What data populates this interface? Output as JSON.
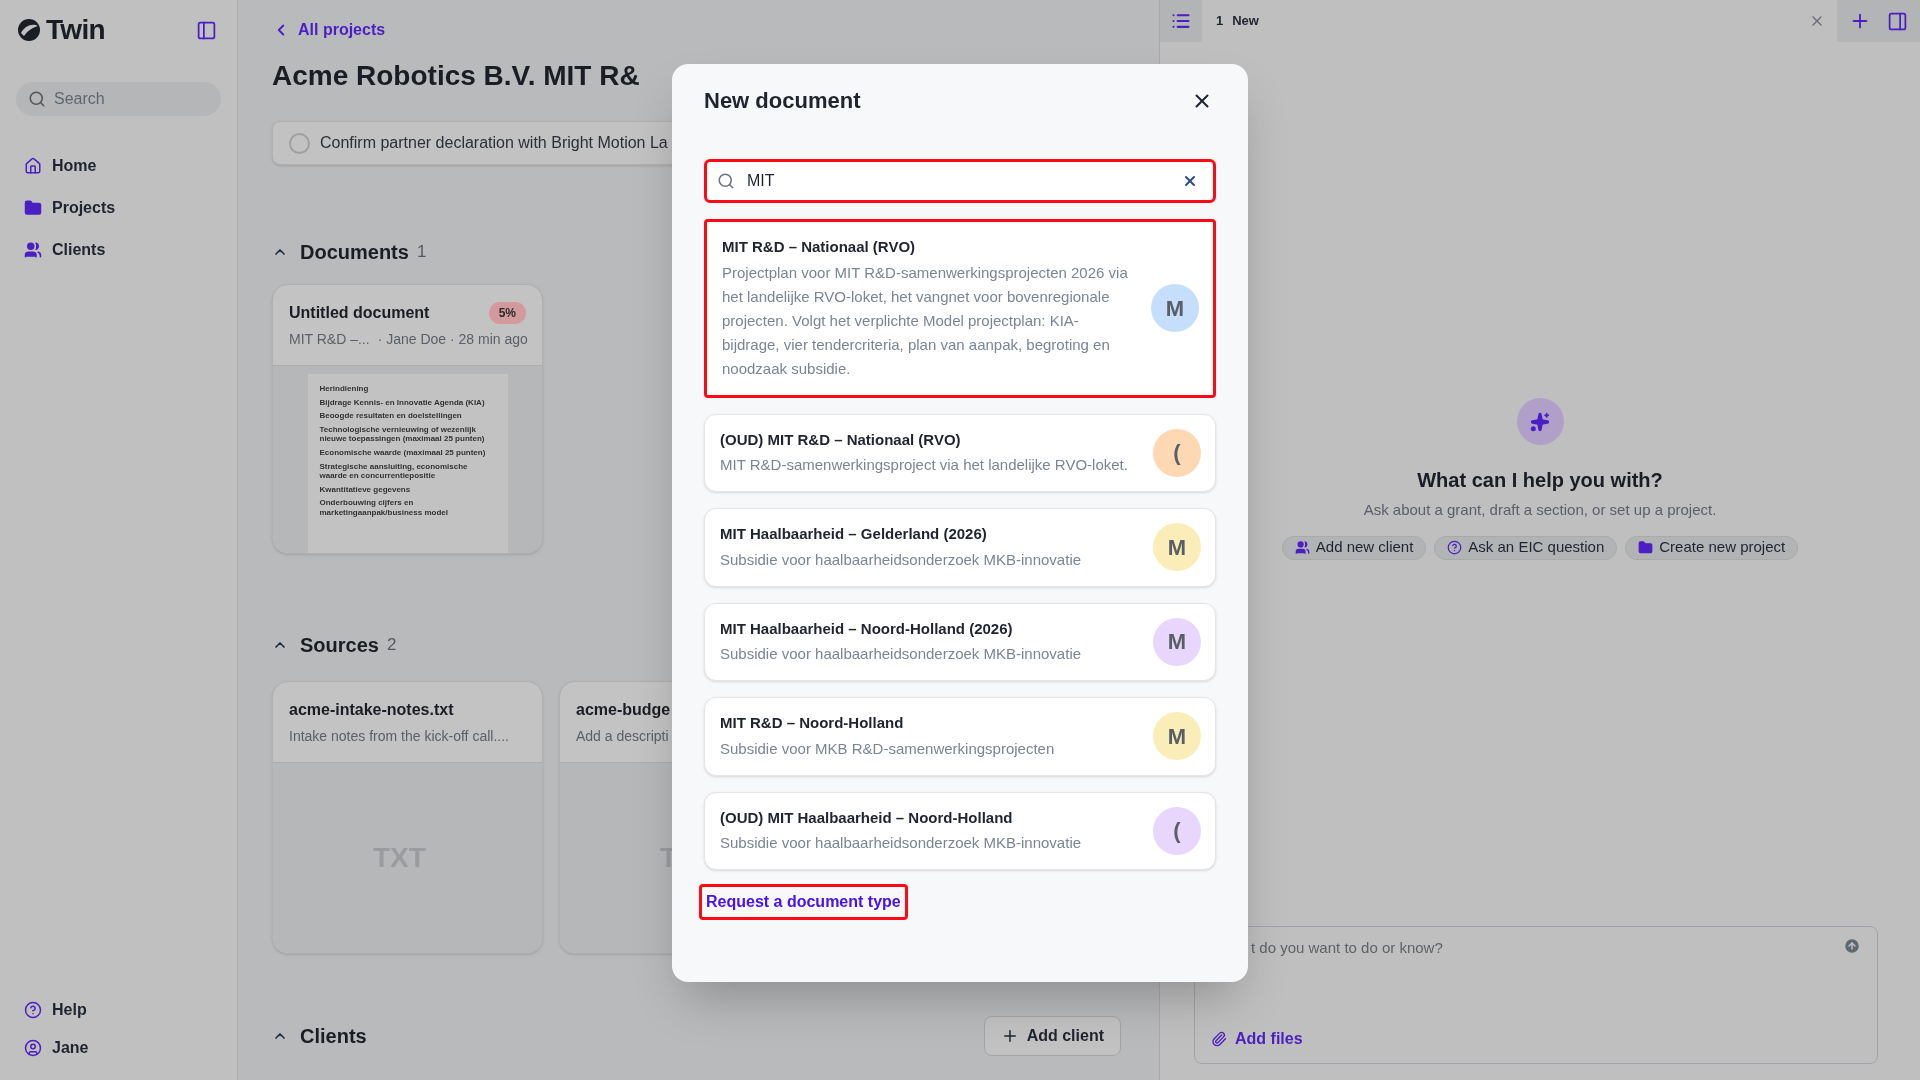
{
  "sidebar": {
    "logo": "Twin",
    "search_placeholder": "Search",
    "nav": [
      {
        "kind": "home",
        "label": "Home"
      },
      {
        "kind": "projects",
        "label": "Projects"
      },
      {
        "kind": "clients",
        "label": "Clients"
      }
    ],
    "footer": [
      {
        "kind": "help",
        "label": "Help"
      },
      {
        "kind": "user",
        "label": "Jane"
      }
    ]
  },
  "main": {
    "back_link": "All projects",
    "title": "Acme Robotics B.V. MIT R&",
    "task": {
      "label": "Confirm partner declaration with Bright Motion La",
      "checked": false
    },
    "documents": {
      "title": "Documents",
      "count": "1",
      "expanded": true,
      "items": [
        {
          "title": "Untitled document",
          "progress": "5%",
          "type": "MIT R&D –...",
          "meta": "· Jane Doe · 28 min ago",
          "preview": [
            "Herindiening",
            "Bijdrage Kennis- en Innovatie Agenda (KIA)",
            "Beoogde resultaten en doelstellingen",
            "Technologische vernieuwing of wezenlijk nieuwe toepassingen (maximaal 25 punten)",
            "Economische waarde (maximaal 25 punten)",
            "Strategische aansluiting, economische waarde en concurrentiepositie",
            "Kwantitatieve gegevens",
            "Onderbouwing cijfers en marketingaanpak/business model"
          ]
        }
      ]
    },
    "sources": {
      "title": "Sources",
      "count": "2",
      "expanded": true,
      "items": [
        {
          "name": "acme-intake-notes.txt",
          "description": "Intake notes from the kick-off call....",
          "file_type": "TXT"
        },
        {
          "name": "acme-budge",
          "description": "Add a descripti",
          "file_type": "T"
        }
      ]
    },
    "clients": {
      "title": "Clients",
      "expanded": true,
      "add_button": "Add client"
    }
  },
  "right_panel": {
    "tab": {
      "index": "1",
      "label": "New"
    },
    "heading": "What can I help you with?",
    "subtitle": "Ask about a grant, draft a section, or set up a project.",
    "chips": [
      {
        "kind": "client",
        "label": "Add new client"
      },
      {
        "kind": "question",
        "label": "Ask an EIC question"
      },
      {
        "kind": "project",
        "label": "Create new project"
      }
    ],
    "chat_input": {
      "placeholder": "t do you want to do or know?"
    },
    "add_files": "Add files"
  },
  "modal": {
    "title": "New document",
    "search": {
      "value": "MIT",
      "focused": true
    },
    "templates": [
      {
        "title": "MIT R&D – Nationaal (RVO)",
        "description": "Projectplan voor MIT R&D-samenwerkingsprojecten 2026 via het landelijke RVO-loket, het vangnet voor bovenregionale projecten. Volgt het verplichte Model projectplan: KIA-bijdrage, vier tendercriteria, plan van aanpak, begroting en noodzaak subsidie.",
        "initial": "M",
        "color": "#c4defc",
        "selected": true
      },
      {
        "title": "(OUD) MIT R&D – Nationaal (RVO)",
        "description": "MIT R&D-samenwerkingsproject via het landelijke RVO-loket.",
        "initial": "(",
        "color": "#fed8b2",
        "selected": false
      },
      {
        "title": "MIT Haalbaarheid – Gelderland (2026)",
        "description": "Subsidie voor haalbaarheidsonderzoek MKB-innovatie",
        "initial": "M",
        "color": "#fbedb8",
        "selected": false
      },
      {
        "title": "MIT Haalbaarheid – Noord-Holland (2026)",
        "description": "Subsidie voor haalbaarheidsonderzoek MKB-innovatie",
        "initial": "M",
        "color": "#e8d6fc",
        "selected": false
      },
      {
        "title": "MIT R&D – Noord-Holland",
        "description": "Subsidie voor MKB R&D-samenwerkingsprojecten",
        "initial": "M",
        "color": "#fbedb8",
        "selected": false
      },
      {
        "title": "(OUD) MIT Haalbaarheid – Noord-Holland",
        "description": "Subsidie voor haalbaarheidsonderzoek MKB-innovatie",
        "initial": "(",
        "color": "#e8d6fc",
        "selected": false
      }
    ],
    "request_link": {
      "label": "Request a document type",
      "highlighted": true
    }
  }
}
